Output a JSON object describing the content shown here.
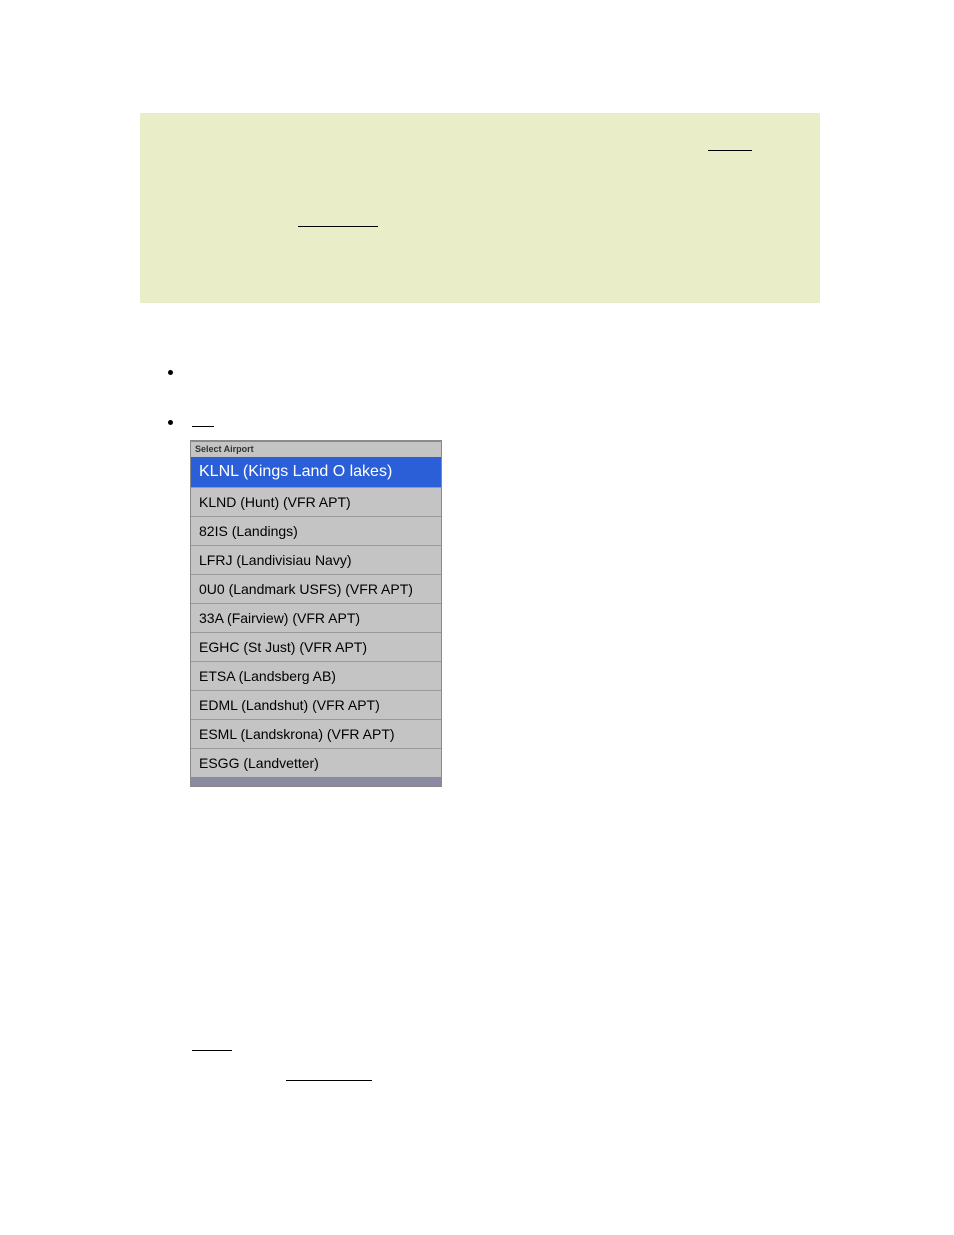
{
  "panel": {
    "title": "Select Airport",
    "items": [
      {
        "label": "KLNL (Kings Land O lakes)",
        "selected": true
      },
      {
        "label": "KLND (Hunt) (VFR APT)"
      },
      {
        "label": "82IS (Landings)"
      },
      {
        "label": "LFRJ (Landivisiau Navy)"
      },
      {
        "label": "0U0 (Landmark USFS) (VFR APT)"
      },
      {
        "label": "33A (Fairview) (VFR APT)"
      },
      {
        "label": "EGHC (St Just) (VFR APT)"
      },
      {
        "label": "ETSA (Landsberg AB)"
      },
      {
        "label": "EDML (Landshut) (VFR APT)"
      },
      {
        "label": "ESML (Landskrona) (VFR APT)"
      },
      {
        "label": "ESGG (Landvetter)"
      }
    ]
  }
}
